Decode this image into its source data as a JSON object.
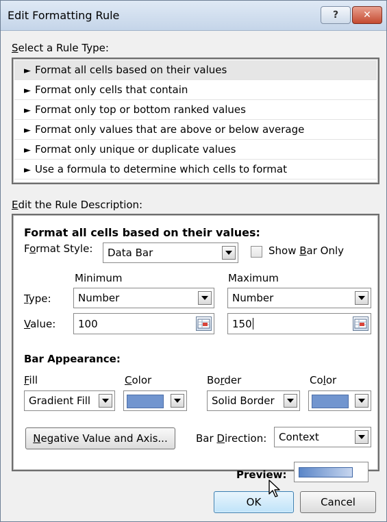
{
  "window": {
    "title": "Edit Formatting Rule",
    "help_label": "?",
    "close_label": "✕"
  },
  "rule_type": {
    "label_prefix": "S",
    "label_rest": "elect a Rule Type:",
    "items": [
      {
        "label": "Format all cells based on their values",
        "selected": true
      },
      {
        "label": "Format only cells that contain",
        "selected": false
      },
      {
        "label": "Format only top or bottom ranked values",
        "selected": false
      },
      {
        "label": "Format only values that are above or below average",
        "selected": false
      },
      {
        "label": "Format only unique or duplicate values",
        "selected": false
      },
      {
        "label": "Use a formula to determine which cells to format",
        "selected": false
      }
    ],
    "arrow": "►"
  },
  "description": {
    "label_prefix": "E",
    "label_rest": "dit the Rule Description:",
    "heading": "Format all cells based on their values:",
    "format_style": {
      "label_a": "F",
      "label_u": "o",
      "label_b": "rmat Style:",
      "value": "Data Bar"
    },
    "show_bar_only": {
      "label_a": "Show ",
      "label_u": "B",
      "label_b": "ar Only",
      "checked": false
    },
    "minimum_header": "Minimum",
    "maximum_header": "Maximum",
    "type": {
      "label_u": "T",
      "label_rest": "ype:",
      "min_value": "Number",
      "max_value": "Number"
    },
    "value": {
      "label_u": "V",
      "label_rest": "alue:",
      "min_value": "100",
      "max_value": "150"
    },
    "bar_appearance": {
      "heading": "Bar Appearance:",
      "fill_label_u": "F",
      "fill_label_rest": "ill",
      "fill_value": "Gradient Fill",
      "color_label_u": "C",
      "color_label_rest": "olor",
      "border_label_a": "Bo",
      "border_label_u": "r",
      "border_label_rest": "der",
      "border_value": "Solid Border",
      "border_color_label_a": "Co",
      "border_color_label_u": "l",
      "border_color_label_rest": "or",
      "fill_color": "#7195cf",
      "border_color": "#7195cf"
    },
    "negative_button": {
      "label_u": "N",
      "label_rest": "egative Value and Axis..."
    },
    "bar_direction": {
      "label_a": "Bar ",
      "label_u": "D",
      "label_rest": "irection:",
      "value": "Context"
    },
    "preview_label": "Preview:"
  },
  "footer": {
    "ok_label": "OK",
    "cancel_label": "Cancel"
  }
}
